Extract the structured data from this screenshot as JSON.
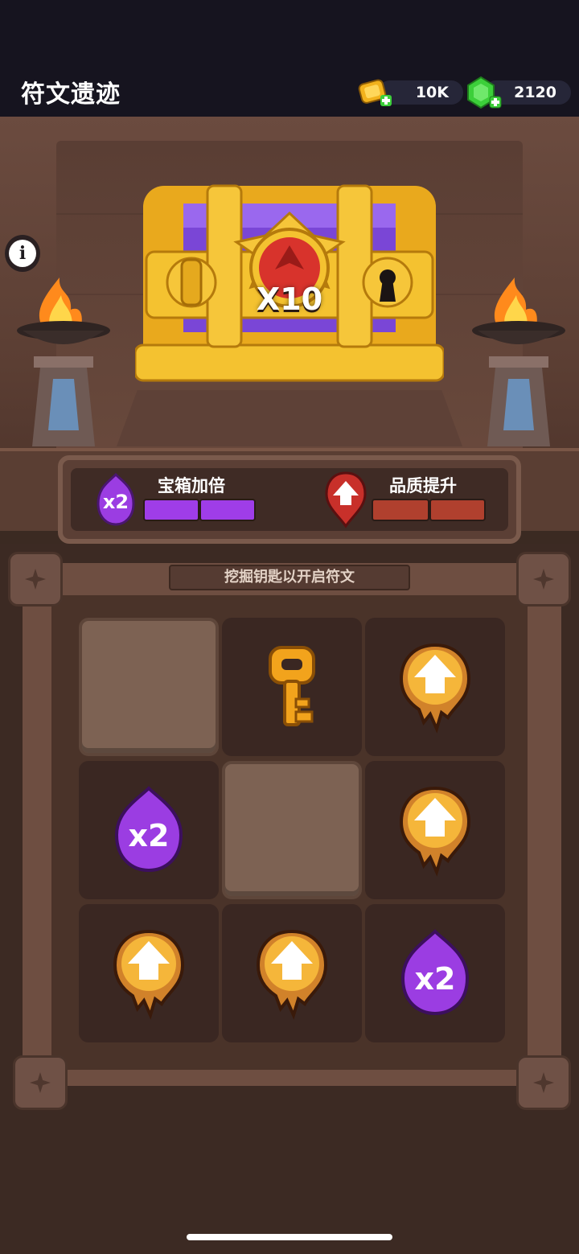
{
  "header": {
    "title": "符文遗迹",
    "gold_amount": "10K",
    "gem_amount": "2120"
  },
  "chest": {
    "multiplier_label": "X10"
  },
  "boosts": {
    "chest_double": {
      "label": "宝箱加倍",
      "badge": "x2",
      "filled": 2,
      "total": 2
    },
    "quality_up": {
      "label": "品质提升",
      "filled": 2,
      "total": 2
    }
  },
  "board": {
    "hint": "挖掘钥匙以开启符文",
    "cells": [
      {
        "type": "covered"
      },
      {
        "type": "key"
      },
      {
        "type": "quality-up"
      },
      {
        "type": "double",
        "label": "x2"
      },
      {
        "type": "covered"
      },
      {
        "type": "quality-up"
      },
      {
        "type": "quality-up"
      },
      {
        "type": "quality-up"
      },
      {
        "type": "double",
        "label": "x2"
      }
    ]
  },
  "colors": {
    "purple": "#9f3de8",
    "red": "#b0402e",
    "gold": "#f2b21c",
    "gem": "#3ccf3a"
  }
}
